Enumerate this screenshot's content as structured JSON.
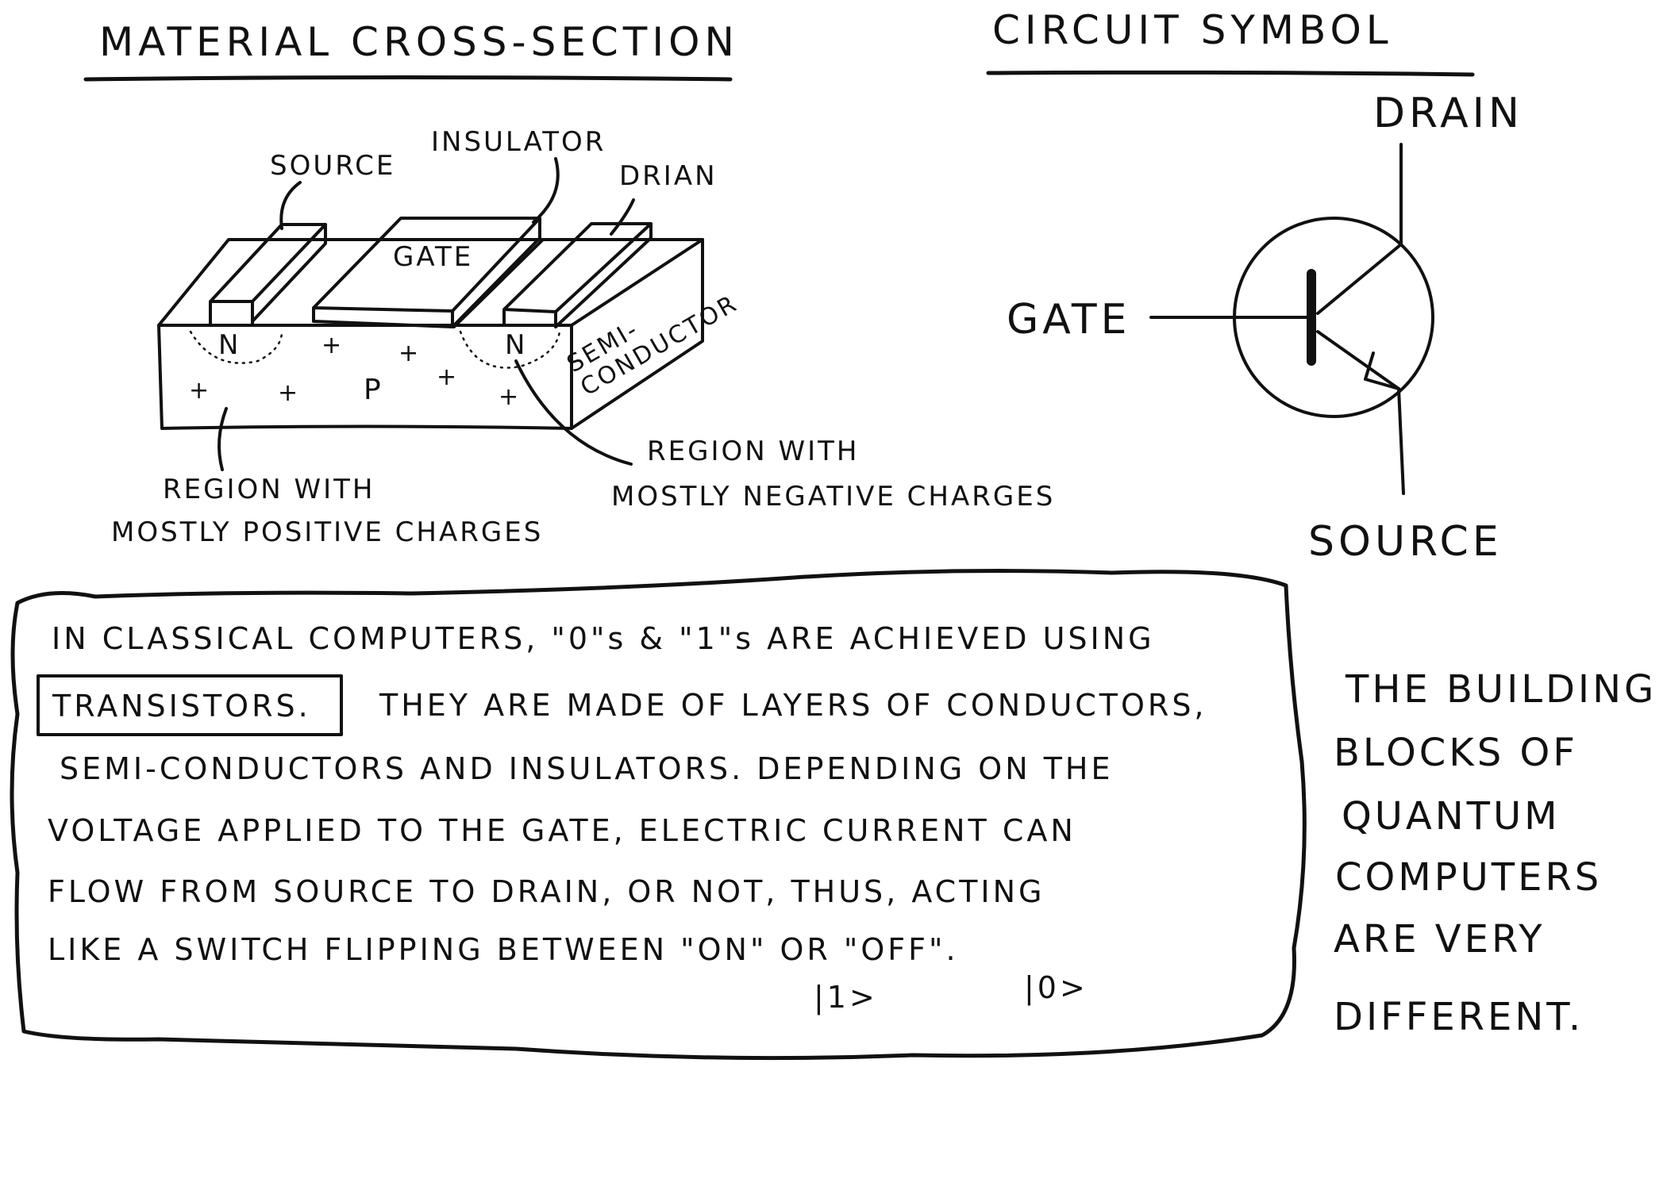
{
  "cross_section": {
    "title": "MATERIAL CROSS-SECTION",
    "labels": {
      "source": "SOURCE",
      "insulator": "INSULATOR",
      "drain": "DRIAN",
      "gate": "GATE",
      "n_left": "N",
      "n_right": "N",
      "p": "P",
      "semi_line1": "SEMI-",
      "semi_line2": "CONDUCTOR",
      "positive_line1": "REGION WITH",
      "positive_line2": "MOSTLY POSITIVE CHARGES",
      "negative_line1": "REGION WITH",
      "negative_line2": "MOSTLY NEGATIVE CHARGES"
    },
    "plus_sign": "+"
  },
  "circuit_symbol": {
    "title": "CIRCUIT SYMBOL",
    "drain": "DRAIN",
    "gate": "GATE",
    "source": "SOURCE"
  },
  "explanation": {
    "line1": "IN CLASSICAL COMPUTERS, \"0\"s & \"1\"s ARE ACHIEVED USING",
    "highlight": "TRANSISTORS.",
    "line2_rest": "THEY ARE MADE OF LAYERS OF CONDUCTORS,",
    "line3": "SEMI-CONDUCTORS AND INSULATORS. DEPENDING ON THE",
    "line4": "VOLTAGE APPLIED TO THE GATE, ELECTRIC CURRENT CAN",
    "line5": "FLOW FROM SOURCE TO DRAIN, OR NOT, THUS, ACTING",
    "line6": "LIKE A SWITCH FLIPPING BETWEEN \"ON\" OR \"OFF\".",
    "ket_on": "|1>",
    "ket_off": "|0>"
  },
  "side_note": {
    "lines": [
      "THE BUILDING",
      "BLOCKS OF",
      "QUANTUM",
      "COMPUTERS",
      "ARE VERY",
      "DIFFERENT."
    ]
  }
}
